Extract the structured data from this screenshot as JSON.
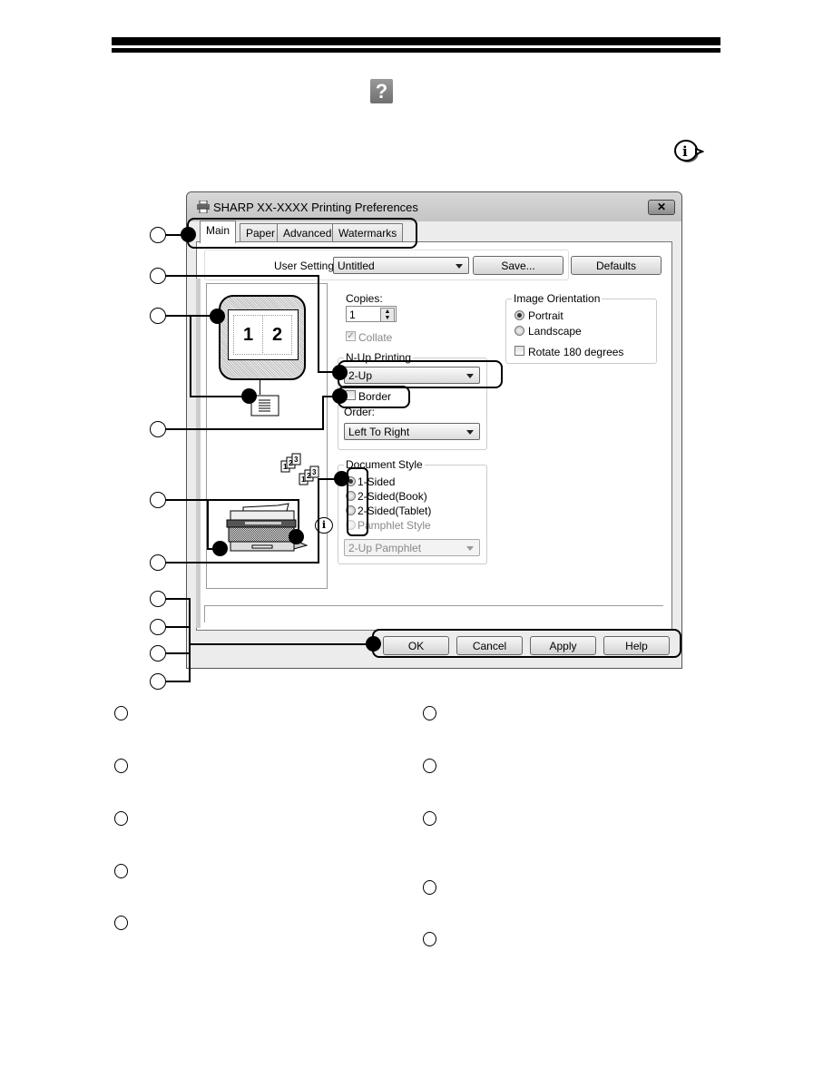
{
  "dialog": {
    "title": "SHARP XX-XXXX Printing Preferences",
    "close_label": "✕",
    "tabs": [
      {
        "label": "Main",
        "active": true
      },
      {
        "label": "Paper",
        "active": false
      },
      {
        "label": "Advanced",
        "active": false
      },
      {
        "label": "Watermarks",
        "active": false
      }
    ],
    "user_settings": {
      "label": "User Settings:",
      "value": "Untitled",
      "save_label": "Save..."
    },
    "defaults_label": "Defaults",
    "preview": {
      "page_left": "1",
      "page_right": "2"
    },
    "copies": {
      "label": "Copies:",
      "value": "1"
    },
    "collate": {
      "label": "Collate",
      "checked": true,
      "enabled": false
    },
    "nup": {
      "group_label": "N-Up Printing",
      "value": "2-Up",
      "border_label": "Border",
      "border_checked": false,
      "order_label": "Order:",
      "order_value": "Left To Right"
    },
    "image_orientation": {
      "group_label": "Image Orientation",
      "options": [
        {
          "label": "Portrait",
          "selected": true
        },
        {
          "label": "Landscape",
          "selected": false
        }
      ],
      "rotate_label": "Rotate 180 degrees",
      "rotate_checked": false
    },
    "document_style": {
      "group_label": "Document Style",
      "options": [
        {
          "label": "1-Sided",
          "selected": true,
          "enabled": true
        },
        {
          "label": "2-Sided(Book)",
          "selected": false,
          "enabled": true
        },
        {
          "label": "2-Sided(Tablet)",
          "selected": false,
          "enabled": true
        },
        {
          "label": "Pamphlet Style",
          "selected": false,
          "enabled": false
        }
      ],
      "pamphlet_value": "2-Up Pamphlet"
    },
    "buttons": {
      "ok": "OK",
      "cancel": "Cancel",
      "apply": "Apply",
      "help": "Help"
    }
  },
  "icons": {
    "help": "?",
    "info": "i"
  }
}
